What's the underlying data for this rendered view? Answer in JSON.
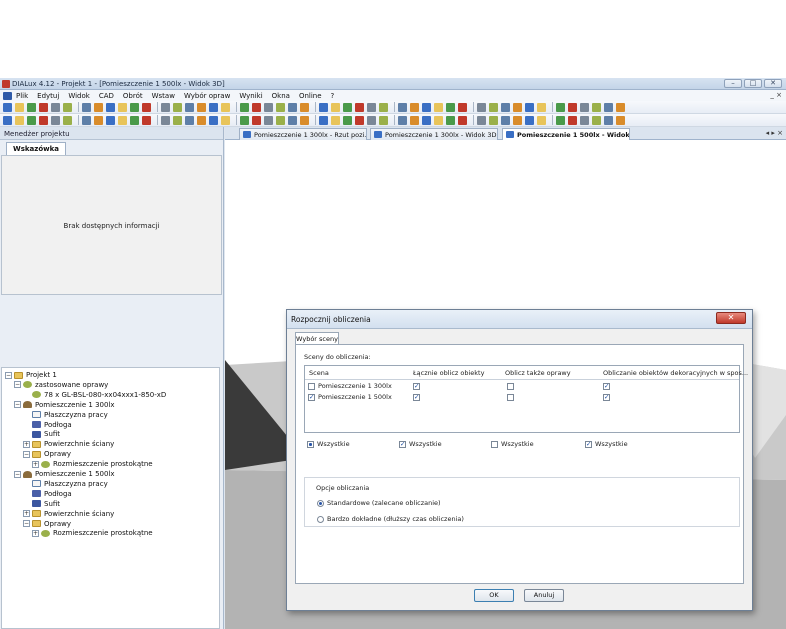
{
  "window": {
    "title": "DIALux 4.12 - Projekt 1 - [Pomieszczenie 1 500lx - Widok 3D]",
    "buttons": [
      "–",
      "□",
      "✕"
    ]
  },
  "menu": {
    "items": [
      "Plik",
      "Edytuj",
      "Widok",
      "CAD",
      "Obrót",
      "Wstaw",
      "Wybór opraw",
      "Wyniki",
      "Okna",
      "Online",
      "?"
    ],
    "mdi_controls": "_ ×"
  },
  "left_pane": {
    "header": "Menedżer projektu",
    "hint_tab": "Wskazówka",
    "hint_message": "Brak dostępnych informacji"
  },
  "tree": [
    {
      "label": "Projekt 1",
      "level": 0,
      "exp": "−",
      "icon": "folder"
    },
    {
      "label": "zastosowane oprawy",
      "level": 1,
      "exp": "−",
      "icon": "lum"
    },
    {
      "label": "78 x GL-BSL-080-xx04xxx1-850-xD",
      "level": 2,
      "exp": "",
      "icon": "lum"
    },
    {
      "label": "Pomieszczenie 1 300lx",
      "level": 1,
      "exp": "−",
      "icon": "room"
    },
    {
      "label": "Płaszczyzna pracy",
      "level": 2,
      "exp": "",
      "icon": "plane"
    },
    {
      "label": "Podłoga",
      "level": 2,
      "exp": "",
      "icon": "floor"
    },
    {
      "label": "Sufit",
      "level": 2,
      "exp": "",
      "icon": "ceil"
    },
    {
      "label": "Powierzchnie ściany",
      "level": 2,
      "exp": "+",
      "icon": "folder"
    },
    {
      "label": "Oprawy",
      "level": 2,
      "exp": "−",
      "icon": "folder"
    },
    {
      "label": "Rozmieszczenie prostokątne",
      "level": 3,
      "exp": "+",
      "icon": "lum"
    },
    {
      "label": "Pomieszczenie 1 500lx",
      "level": 1,
      "exp": "−",
      "icon": "room"
    },
    {
      "label": "Płaszczyzna pracy",
      "level": 2,
      "exp": "",
      "icon": "plane"
    },
    {
      "label": "Podłoga",
      "level": 2,
      "exp": "",
      "icon": "floor"
    },
    {
      "label": "Sufit",
      "level": 2,
      "exp": "",
      "icon": "ceil"
    },
    {
      "label": "Powierzchnie ściany",
      "level": 2,
      "exp": "+",
      "icon": "folder"
    },
    {
      "label": "Oprawy",
      "level": 2,
      "exp": "−",
      "icon": "folder"
    },
    {
      "label": "Rozmieszczenie prostokątne",
      "level": 3,
      "exp": "+",
      "icon": "lum"
    }
  ],
  "doc_tabs": [
    {
      "label": "Pomieszczenie 1 300lx - Rzut pozi...",
      "active": false
    },
    {
      "label": "Pomieszczenie 1 300lx - Widok 3D",
      "active": false
    },
    {
      "label": "Pomieszczenie 1 500lx - Widok...",
      "active": true
    }
  ],
  "tab_nav": "◂ ▸ ×",
  "dialog": {
    "title": "Rozpocznij obliczenia",
    "close": "✕",
    "tab": "Wybór sceny",
    "scenes_label": "Sceny do obliczenia:",
    "columns": [
      "Scena",
      "Łącznie oblicz obiekty",
      "Oblicz także oprawy",
      "Obliczanie obiektów dekoracyjnych w spos..."
    ],
    "rows": [
      {
        "name": "Pomieszczenie 1 300lx",
        "scene": false,
        "objects": true,
        "lum": false,
        "deco": true
      },
      {
        "name": "Pomieszczenie 1 500lx",
        "scene": true,
        "objects": true,
        "lum": false,
        "deco": true
      }
    ],
    "all_label": "Wszystkie",
    "all_states": [
      "partial",
      "checked",
      "unchecked",
      "checked"
    ],
    "options_label": "Opcje obliczania",
    "option_standard": "Standardowe (zalecane obliczanie)",
    "option_detailed": "Bardzo dokładne (dłuższy czas obliczenia)",
    "selected_option": "standard",
    "ok": "OK",
    "cancel": "Anuluj"
  }
}
